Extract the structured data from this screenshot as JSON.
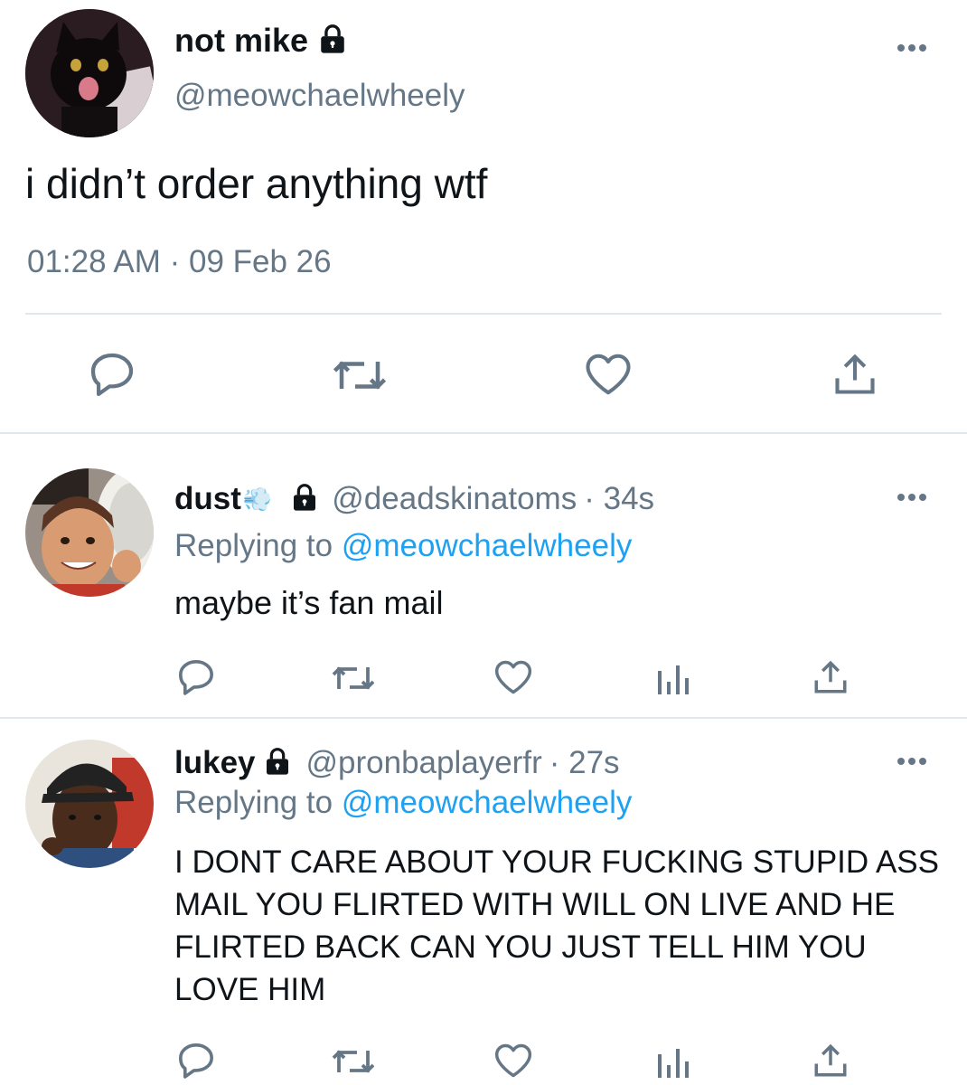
{
  "main_tweet": {
    "display_name": "not mike",
    "handle": "@meowchaelwheely",
    "text": "i didn’t order anything wtf",
    "timestamp": "01:28 AM · 09 Feb 26",
    "locked": true
  },
  "replies": [
    {
      "display_name": "dust",
      "name_emoji": "💨",
      "handle": "@deadskinatoms",
      "time": "· 34s",
      "replying_prefix": "Replying to",
      "replying_to": "@meowchaelwheely",
      "text": "maybe it’s fan mail",
      "locked": true
    },
    {
      "display_name": "lukey",
      "handle": "@pronbaplayerfr",
      "time": "· 27s",
      "replying_prefix": "Replying to",
      "replying_to": "@meowchaelwheely",
      "text": "I DONT CARE ABOUT YOUR FUCKING STUPID ASS MAIL YOU FLIRTED WITH WILL ON LIVE AND HE FLIRTED BACK CAN YOU JUST TELL HIM YOU LOVE HIM",
      "locked": true
    }
  ],
  "icons": [
    "lock-icon",
    "more-icon",
    "reply-icon",
    "retweet-icon",
    "like-icon",
    "share-icon",
    "analytics-icon"
  ],
  "colors": {
    "text": "#0f1419",
    "muted": "#657786",
    "link": "#1da1f2",
    "divider": "#e1e8ed"
  }
}
